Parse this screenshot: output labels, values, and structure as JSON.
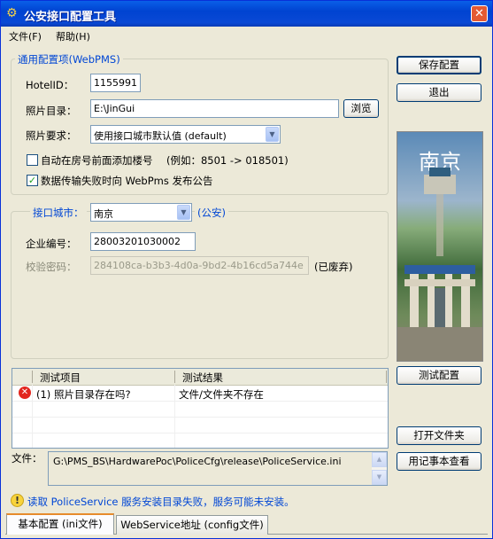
{
  "window": {
    "title": "公安接口配置工具"
  },
  "menu": {
    "file": "文件(F)",
    "help": "帮助(H)"
  },
  "general": {
    "legend": "通用配置项(WebPMS)",
    "hotel_id_label": "HotelID：",
    "hotel_id_value": "1155991",
    "photo_dir_label": "照片目录：",
    "photo_dir_value": "E:\\JinGui",
    "browse_button": "浏览",
    "photo_req_label": "照片要求：",
    "photo_req_value": "使用接口城市默认值 (default)",
    "auto_floor_label": "自动在房号前面添加楼号",
    "auto_floor_checked": false,
    "auto_floor_example": "(例如：8501 -> 018501)",
    "publish_notice_label": "数据传输失败时向 WebPms 发布公告",
    "publish_notice_checked": true
  },
  "city": {
    "legend": "接口城市：",
    "city_value": "南京",
    "police_tag": "(公安)",
    "company_no_label": "企业编号：",
    "company_no_value": "28003201030002",
    "verify_label": "校验密码：",
    "verify_value": "284108ca-b3b3-4d0a-9bd2-4b16cd5a744e",
    "deprecated": "(已废弃)"
  },
  "buttons": {
    "save": "保存配置",
    "exit": "退出",
    "test": "测试配置",
    "open_folder": "打开文件夹",
    "notepad": "用记事本查看"
  },
  "photo": {
    "city_text": "南京"
  },
  "test_list": {
    "columns": [
      "测试项目",
      "测试结果"
    ],
    "rows": [
      {
        "item": "(1) 照片目录存在吗?",
        "result": "文件/文件夹不存在",
        "status": "error"
      }
    ]
  },
  "file": {
    "label": "文件：",
    "path": "G:\\PMS_BS\\HardwarePoc\\PoliceCfg\\release\\PoliceService.ini"
  },
  "status": {
    "message": "读取 PoliceService 服务安装目录失败，服务可能未安装。"
  },
  "tabs": [
    "基本配置 (ini文件)",
    "WebService地址 (config文件)"
  ],
  "colors": {
    "accent": "#0046D5",
    "titlebar": "#0A5FE8",
    "error": "#E2261E",
    "warning": "#F8D33B"
  }
}
